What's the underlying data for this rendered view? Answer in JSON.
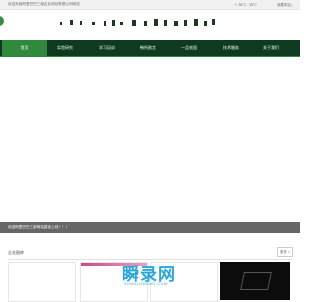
{
  "topbar": {
    "welcome": "欢迎光临阿里巴巴三部企业网站有限公司网站",
    "weather": "28°C - 33°C",
    "favorite": "收藏本站 |"
  },
  "nav": {
    "items": [
      {
        "label": "首页",
        "active": true
      },
      {
        "label": "实验研究",
        "active": false
      },
      {
        "label": "学习培训",
        "active": false
      },
      {
        "label": "畅所欲言",
        "active": false
      },
      {
        "label": "一品农园",
        "active": false
      },
      {
        "label": "技术服务",
        "active": false
      },
      {
        "label": "关于我们",
        "active": false
      }
    ],
    "active_color": "#2f8a3d",
    "bar_color": "#0e3a1f"
  },
  "notice": {
    "text": "欢迎阿里巴巴三部网站建设上线！！！"
  },
  "section": {
    "title": "企业图库",
    "more": "更多 >"
  },
  "watermark": {
    "text": "瞬录网",
    "url": "SHUNLUWANG.COM"
  }
}
